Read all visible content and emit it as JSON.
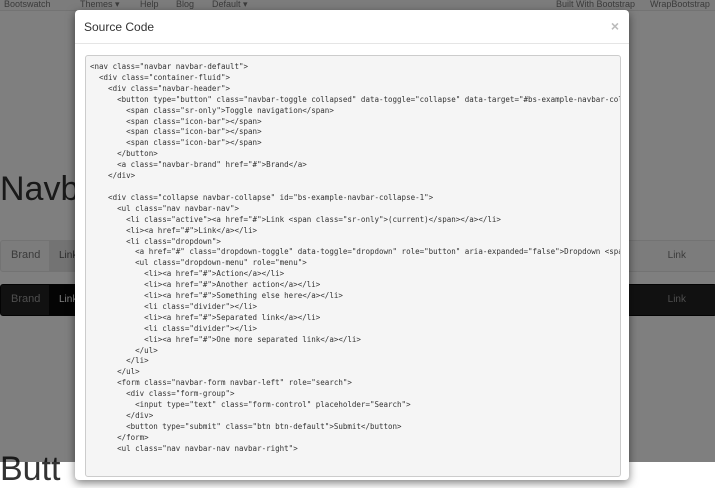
{
  "topnav": {
    "brand": "Bootswatch",
    "themes": "Themes ▾",
    "help": "Help",
    "blog": "Blog",
    "default": "Default ▾",
    "built": "Built With Bootstrap",
    "wrap": "WrapBootstrap"
  },
  "page": {
    "heading": "Navb",
    "heading2": "Butt"
  },
  "demo_light": {
    "brand": "Brand",
    "link1": "Link",
    "link2": "Link"
  },
  "demo_dark": {
    "brand": "Brand",
    "link1": "Link",
    "link2": "Link"
  },
  "modal": {
    "title": "Source Code",
    "close": "×",
    "code_lines": [
      "<nav class=\"navbar navbar-default\">",
      "  <div class=\"container-fluid\">",
      "    <div class=\"navbar-header\">",
      "      <button type=\"button\" class=\"navbar-toggle collapsed\" data-toggle=\"collapse\" data-target=\"#bs-example-navbar-colla",
      "        <span class=\"sr-only\">Toggle navigation</span>",
      "        <span class=\"icon-bar\"></span>",
      "        <span class=\"icon-bar\"></span>",
      "        <span class=\"icon-bar\"></span>",
      "      </button>",
      "      <a class=\"navbar-brand\" href=\"#\">Brand</a>",
      "    </div>",
      "",
      "    <div class=\"collapse navbar-collapse\" id=\"bs-example-navbar-collapse-1\">",
      "      <ul class=\"nav navbar-nav\">",
      "        <li class=\"active\"><a href=\"#\">Link <span class=\"sr-only\">(current)</span></a></li>",
      "        <li><a href=\"#\">Link</a></li>",
      "        <li class=\"dropdown\">",
      "          <a href=\"#\" class=\"dropdown-toggle\" data-toggle=\"dropdown\" role=\"button\" aria-expanded=\"false\">Dropdown <span",
      "          <ul class=\"dropdown-menu\" role=\"menu\">",
      "            <li><a href=\"#\">Action</a></li>",
      "            <li><a href=\"#\">Another action</a></li>",
      "            <li><a href=\"#\">Something else here</a></li>",
      "            <li class=\"divider\"></li>",
      "            <li><a href=\"#\">Separated link</a></li>",
      "            <li class=\"divider\"></li>",
      "            <li><a href=\"#\">One more separated link</a></li>",
      "          </ul>",
      "        </li>",
      "      </ul>",
      "      <form class=\"navbar-form navbar-left\" role=\"search\">",
      "        <div class=\"form-group\">",
      "          <input type=\"text\" class=\"form-control\" placeholder=\"Search\">",
      "        </div>",
      "        <button type=\"submit\" class=\"btn btn-default\">Submit</button>",
      "      </form>",
      "      <ul class=\"nav navbar-nav navbar-right\">"
    ]
  }
}
